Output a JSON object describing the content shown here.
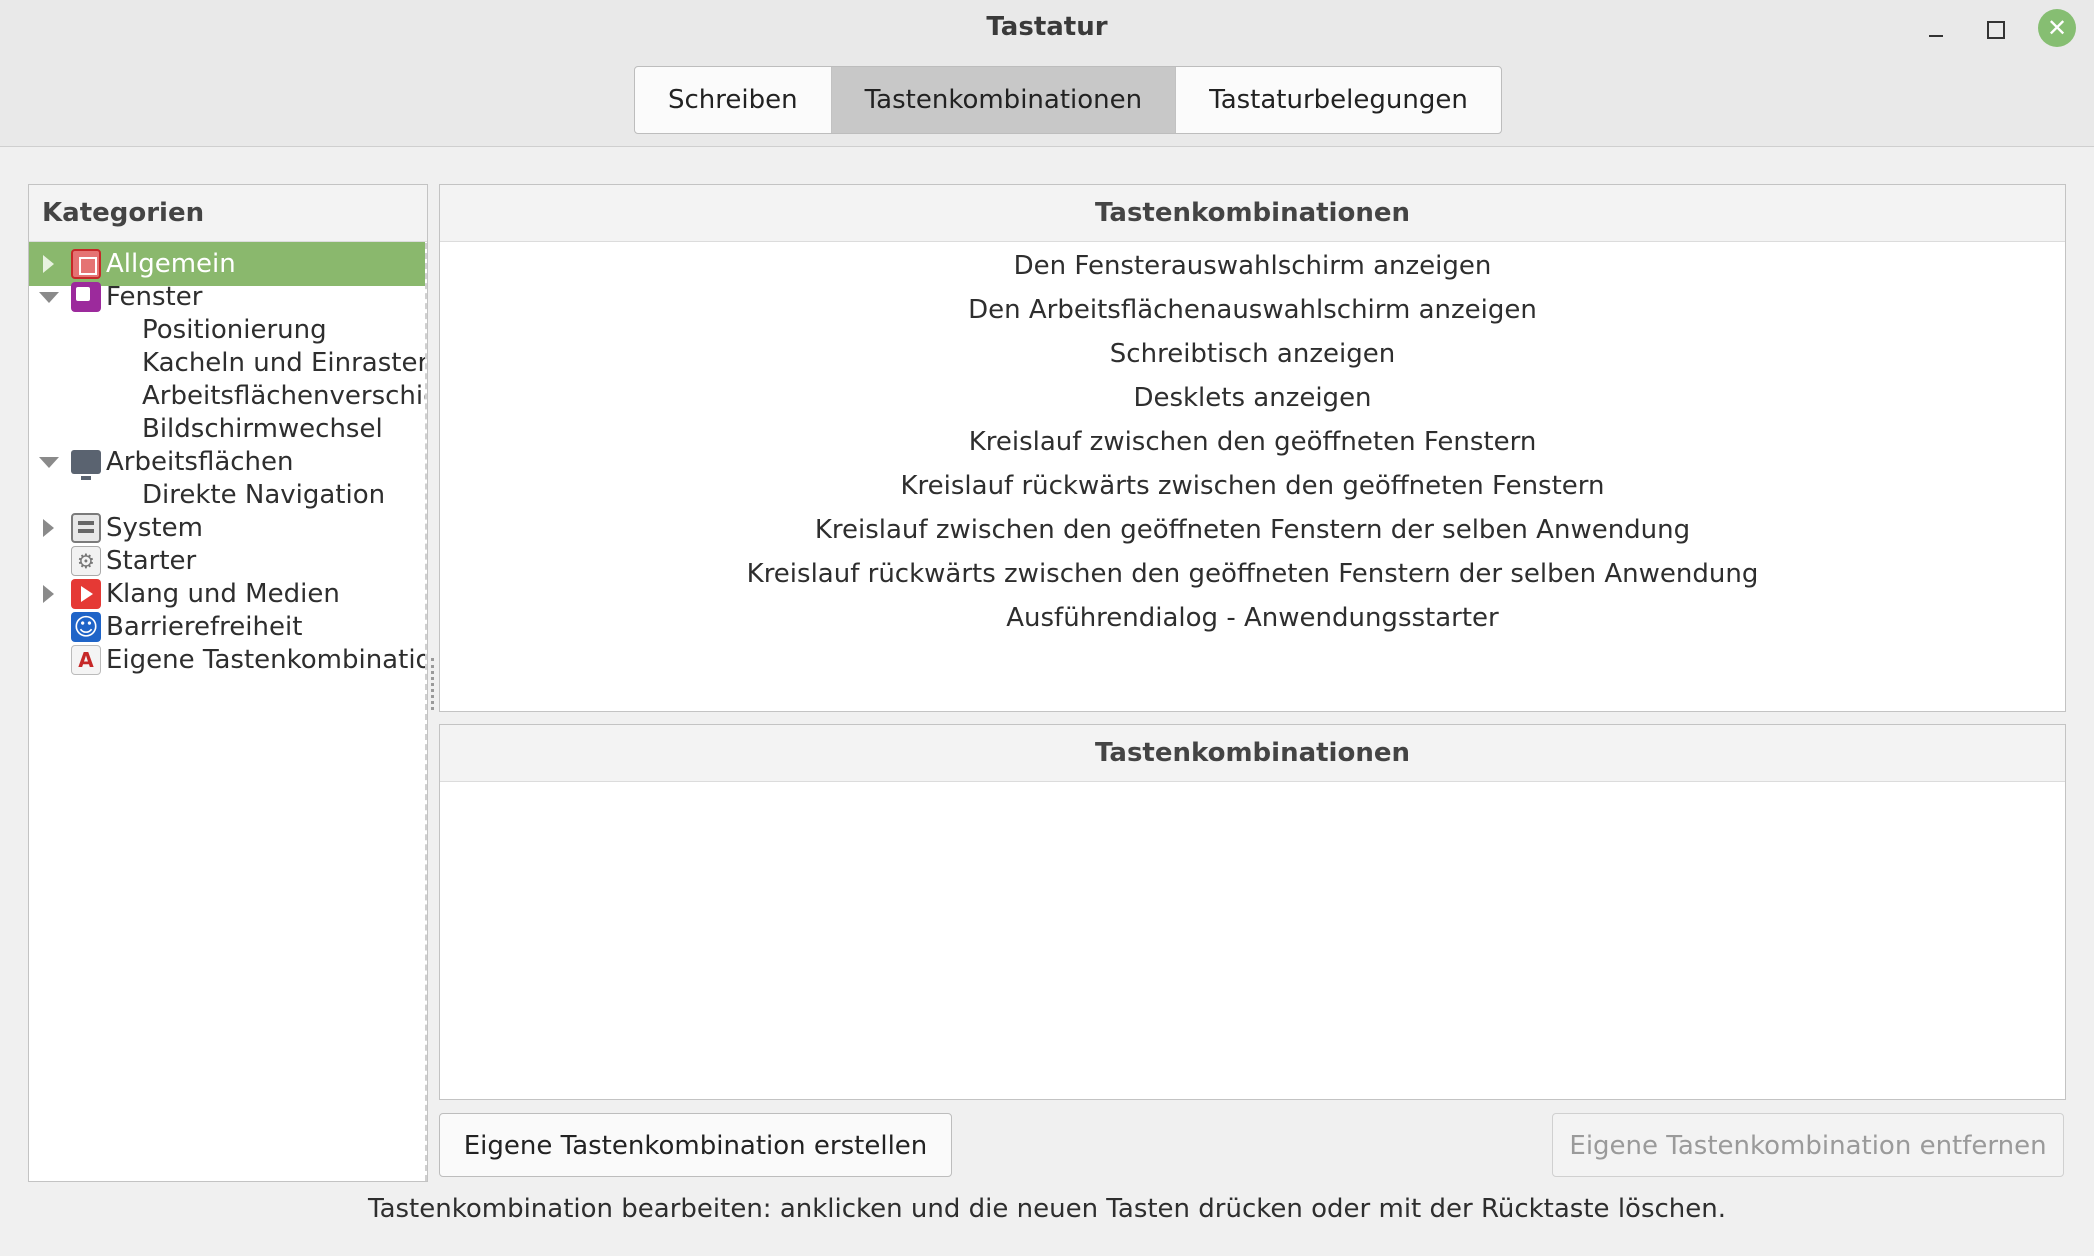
{
  "window": {
    "title": "Tastatur",
    "controls": {
      "minimize": "–",
      "maximize": "□",
      "close": "✕"
    }
  },
  "tabs": [
    {
      "label": "Schreiben",
      "active": false
    },
    {
      "label": "Tastenkombinationen",
      "active": true
    },
    {
      "label": "Tastaturbelegungen",
      "active": false
    }
  ],
  "categories": {
    "header": "Kategorien",
    "items": [
      {
        "label": "Allgemein",
        "icon": "general-icon",
        "selected": true,
        "expander": "collapsed"
      },
      {
        "label": "Fenster",
        "icon": "window-icon",
        "expander": "expanded"
      },
      {
        "label": "Positionierung",
        "child": true
      },
      {
        "label": "Kacheln und Einrasten",
        "child": true
      },
      {
        "label": "Arbeitsflächenverschieb",
        "child": true
      },
      {
        "label": "Bildschirmwechsel",
        "child": true
      },
      {
        "label": "Arbeitsflächen",
        "icon": "workspace-icon",
        "expander": "expanded"
      },
      {
        "label": "Direkte Navigation",
        "child": true
      },
      {
        "label": "System",
        "icon": "system-icon",
        "expander": "collapsed"
      },
      {
        "label": "Starter",
        "icon": "starter-icon"
      },
      {
        "label": "Klang und Medien",
        "icon": "media-icon",
        "expander": "collapsed"
      },
      {
        "label": "Barrierefreiheit",
        "icon": "accessibility-icon"
      },
      {
        "label": "Eigene Tastenkombination",
        "icon": "custom-shortcut-icon"
      }
    ]
  },
  "shortcuts_list": {
    "header": "Tastenkombinationen",
    "items": [
      "Den Fensterauswahlschirm anzeigen",
      "Den Arbeitsflächenauswahlschirm anzeigen",
      "Schreibtisch anzeigen",
      "Desklets anzeigen",
      "Kreislauf zwischen den geöffneten Fenstern",
      "Kreislauf rückwärts zwischen den geöffneten Fenstern",
      "Kreislauf zwischen den geöffneten Fenstern der selben Anwendung",
      "Kreislauf rückwärts zwischen den geöffneten Fenstern der selben Anwendung",
      "Ausführendialog - Anwendungsstarter"
    ]
  },
  "bindings_list": {
    "header": "Tastenkombinationen",
    "items": []
  },
  "buttons": {
    "add_custom": "Eigene Tastenkombination erstellen",
    "remove_custom": "Eigene Tastenkombination entfernen"
  },
  "status": "Tastenkombination bearbeiten: anklicken und die neuen Tasten drücken oder mit der Rücktaste löschen.",
  "colors": {
    "selection": "#8ab86d",
    "close_button": "#86be72",
    "active_tab": "#c8c8c8"
  }
}
